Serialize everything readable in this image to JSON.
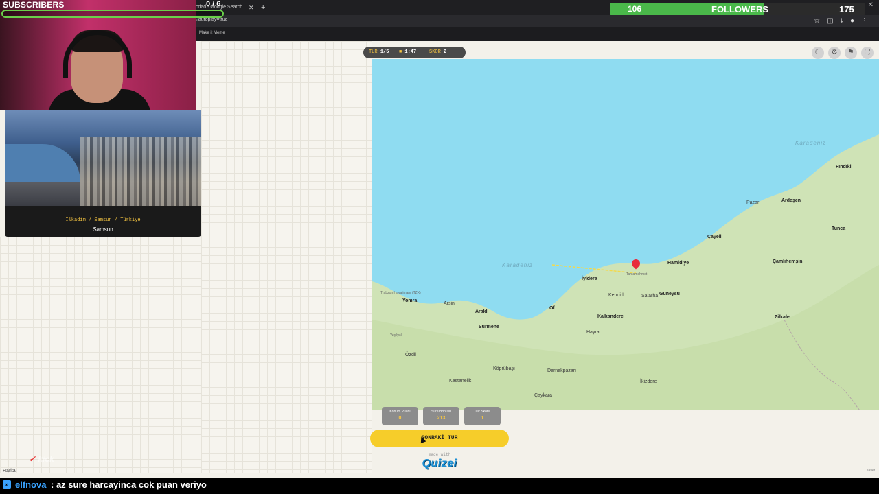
{
  "browser": {
    "tab_title": "cdad - Google Search",
    "url_fragment": "?autoplay=true",
    "bookmark": "Make it Meme",
    "icons": [
      "star-icon",
      "extensions-icon",
      "puzzle-icon",
      "download-icon",
      "profile-icon",
      "menu-icon"
    ]
  },
  "stream": {
    "subscribers_label": "SUBSCRIBERS",
    "subscribers_count": "0 / 6",
    "followers_value": "106",
    "followers_label": "FOLLOWERS",
    "followers_goal": "175",
    "followers_progress": 0.606,
    "chat_user": "elfnova",
    "chat_message": " : az sure harcayinca cok puan veriyo",
    "watermark": "kick"
  },
  "location_card": {
    "path": "Ilkadim / Samsun / Türkiye",
    "city": "Samsun"
  },
  "round_pill": {
    "round_key": "TUR",
    "round_val": "1/5",
    "time_val": "1:47",
    "score_key": "SKOR",
    "score_val": "2"
  },
  "map_icons": [
    "moon-icon",
    "gear-icon",
    "flag-icon",
    "fullscreen-icon"
  ],
  "map": {
    "sea_labels": [
      "Karadeniz",
      "Karadeniz"
    ],
    "places": {
      "findikli": "Fındıklı",
      "ardesen": "Ardeşen",
      "pazar": "Pazar",
      "tunca": "Tunca",
      "cayeli": "Çayeli",
      "hamidiye": "Hamidiye",
      "camlihemsin": "Çamlıhemşin",
      "tahtamehmet": "Tahtamehmet",
      "iyidere": "İyidere",
      "kendirli": "Kendirli",
      "salarha": "Salarha",
      "guneysu": "Güneysu",
      "kalkandere": "Kalkandere",
      "zilkale": "Zilkale",
      "yomra": "Yomra",
      "arsin": "Arsin",
      "arakli": "Araklı",
      "surmene": "Sürmene",
      "of": "Of",
      "hayrat": "Hayrat",
      "yesilyali": "Yeşilyalı",
      "ozdil": "Özdil",
      "kestanelik": "Kestanelik",
      "koprubasi": "Köprübaşı",
      "dernekpazari": "Dernekpazarı",
      "ikizdere": "İkizdere",
      "caykara": "Çaykara",
      "trabzon_airport": "Trabzon Havalimanı (TZX)"
    }
  },
  "score_chips": [
    {
      "label": "Konum Puanı",
      "value": "0"
    },
    {
      "label": "Süre Bonusu",
      "value": "213"
    },
    {
      "label": "Tur Skoru",
      "value": "1"
    }
  ],
  "next_button": "SONRAKİ TUR",
  "made_with": "made with",
  "brand": "Quizei",
  "map_source": "Harita",
  "map_credit": "Leaflet"
}
